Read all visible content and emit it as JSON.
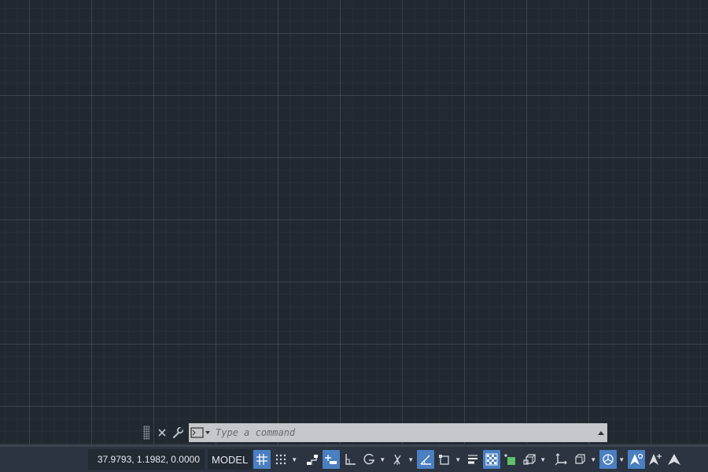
{
  "command_line": {
    "placeholder": "Type a command",
    "close_icon": "close-icon",
    "customize_icon": "wrench-icon",
    "prompt_icon": "command-prompt-icon",
    "expand_icon": "chevron-up-icon"
  },
  "status_bar": {
    "coordinates": "37.9793, 1.1982, 0.0000",
    "space": "MODEL",
    "toggles": {
      "grid": true,
      "snap": false,
      "infer_constraints": false,
      "dynamic_input": true,
      "ortho": false,
      "polar": false,
      "isodraft": false,
      "object_snap_tracking": true,
      "object_snap": false,
      "lineweight": false,
      "transparency": true,
      "selection_cycling": false,
      "3d_osnap": false,
      "ucs": false,
      "gizmo": false,
      "isolate": true,
      "annotation_visibility": true,
      "autoscale": false,
      "annotation_scale": false
    }
  },
  "colors": {
    "canvas": "#212830",
    "status_bar": "#2b3440",
    "accent": "#4a7fc1",
    "command_box": "#c4c7cb"
  }
}
